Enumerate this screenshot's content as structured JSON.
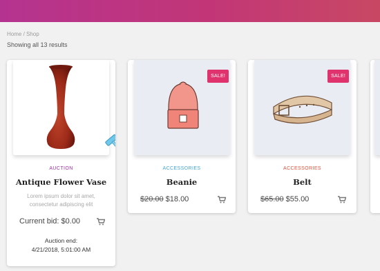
{
  "breadcrumb": "Home / Shop",
  "result_count": "Showing all 13 results",
  "colors": {
    "banner_start": "#b53390",
    "banner_end": "#c84864",
    "sale_badge": "#e0336d",
    "category_auction": "#9b2fa4",
    "category_accessories_blue": "#3fa6d6",
    "category_accessories_red": "#e0503a"
  },
  "products": [
    {
      "category": "Auction",
      "title": "Antique Flower Vase",
      "description": "Lorem ipsum dolor sit amet, consectetur adipiscing elit",
      "price_label": "Current bid: $0.00",
      "auction_end_label": "Auction end:",
      "auction_end_value": "4/21/2018, 5:01:00 AM",
      "icon": "auction-hammer-icon"
    },
    {
      "category": "Accessories",
      "title": "Beanie",
      "sale_badge": "SALE!",
      "old_price": "$20.00",
      "price": "$18.00",
      "icon": "cart-icon"
    },
    {
      "category": "Accessories",
      "title": "Belt",
      "sale_badge": "SALE!",
      "old_price": "$65.00",
      "price": "$55.00",
      "icon": "cart-icon"
    }
  ]
}
